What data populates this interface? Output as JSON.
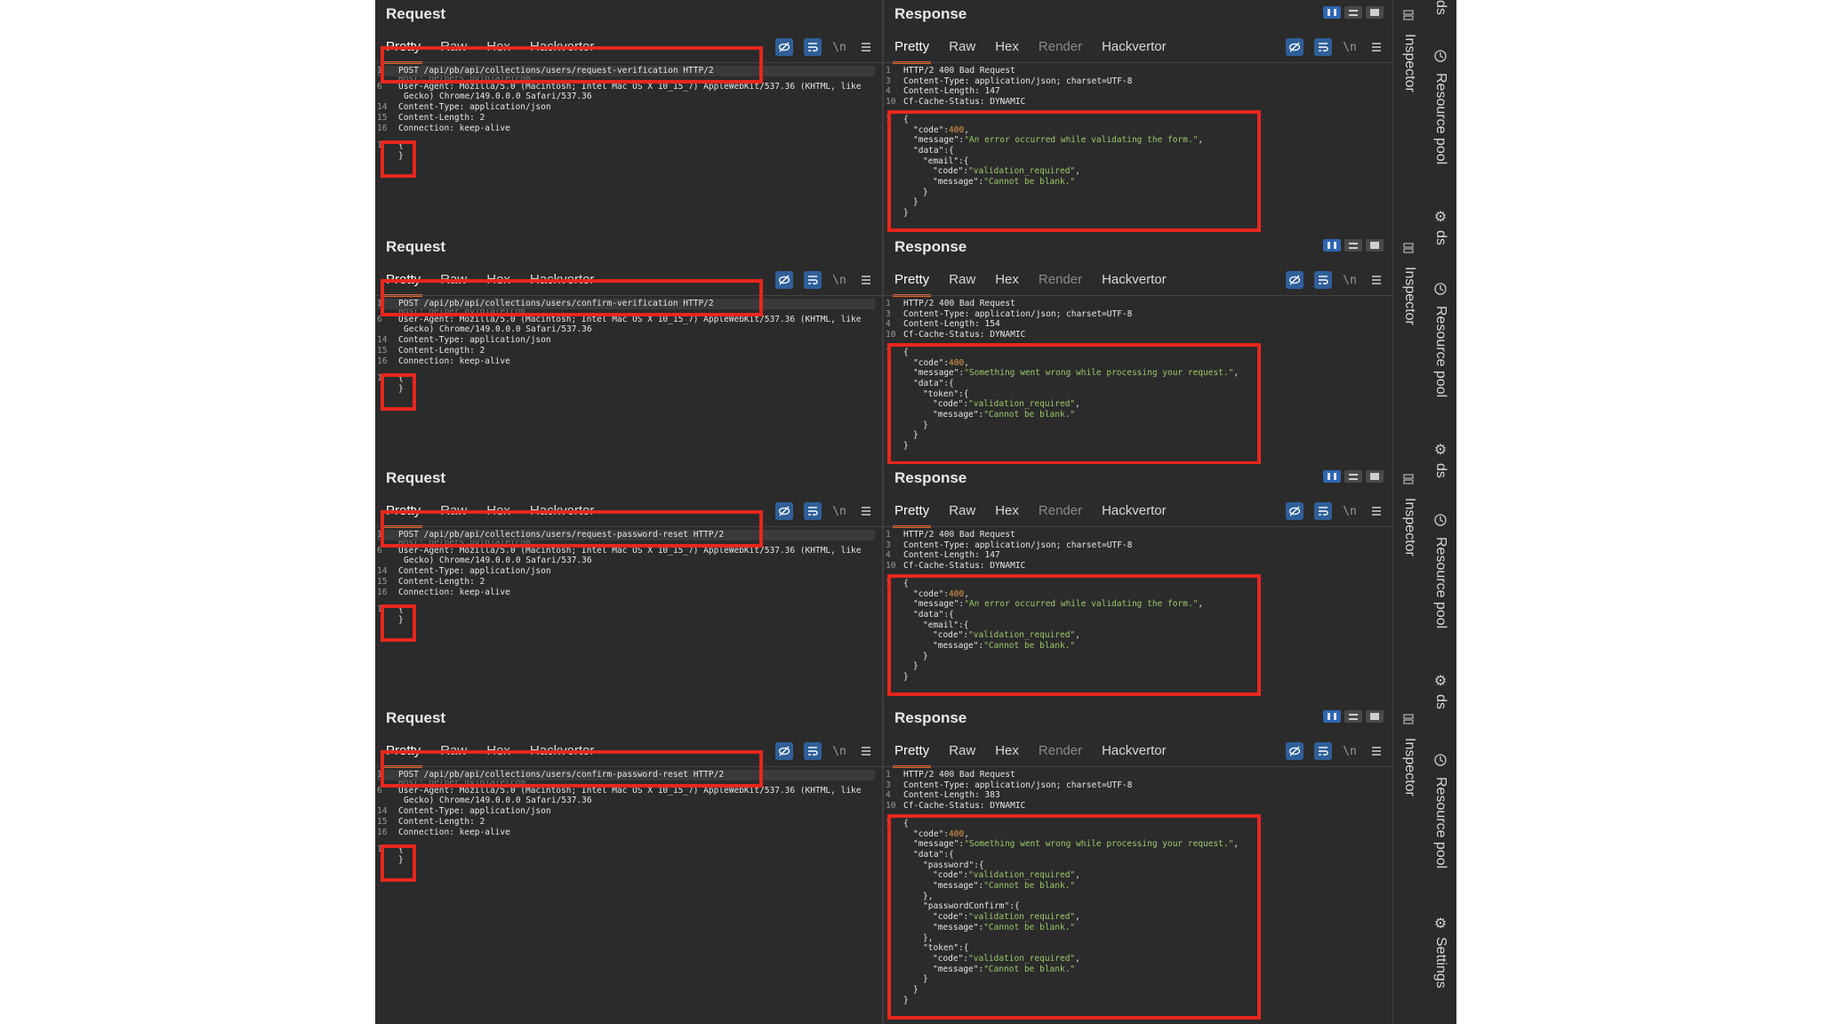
{
  "request_pane": {
    "title": "Request",
    "tabs": [
      "Pretty",
      "Raw",
      "Hex",
      "Hackvertor"
    ]
  },
  "response_pane": {
    "title": "Response",
    "tabs": [
      "Pretty",
      "Raw",
      "Hex",
      "Render",
      "Hackvertor"
    ]
  },
  "tools": {
    "newline_label": "\\n"
  },
  "sidebar": {
    "inspector": "Inspector",
    "resource_pool": "Resource pool",
    "settings": "Settings",
    "ds": "ds"
  },
  "rows": [
    {
      "request": {
        "request_line": "POST /api/pb/api/collections/users/request-verification HTTP/2",
        "host_line": "Host: helpers.dyjbjafetcom",
        "ua_line_a": "User-Agent: Mozilla/5.0 (Macintosh; Intel Mac OS X 10_15_7) AppleWebKit/537.36 (KHTML, like",
        "ua_line_b": "Gecko) Chrome/149.0.0.0 Safari/537.36",
        "content_type": "Content-Type: application/json",
        "content_length": "Content-Length: 2",
        "connection": "Connection: keep-alive",
        "body_open": "{",
        "body_close": "}"
      },
      "response": {
        "status": "HTTP/2 400 Bad Request",
        "content_type": "Content-Type: application/json; charset=UTF-8",
        "content_length": "Content-Length: 147",
        "cache": "Cf-Cache-Status: DYNAMIC",
        "body_lines": [
          {
            "indent": 0,
            "t": "{"
          },
          {
            "indent": 1,
            "key": "\"code\":",
            "num": "400",
            "tail": ","
          },
          {
            "indent": 1,
            "key": "\"message\":",
            "str": "\"An error occurred while validating the form.\"",
            "tail": ","
          },
          {
            "indent": 1,
            "key": "\"data\":",
            "tail": "{"
          },
          {
            "indent": 2,
            "key": "\"email\":",
            "tail": "{"
          },
          {
            "indent": 3,
            "key": "\"code\":",
            "str": "\"validation_required\"",
            "tail": ","
          },
          {
            "indent": 3,
            "key": "\"message\":",
            "str": "\"Cannot be blank.\""
          },
          {
            "indent": 2,
            "t": "}"
          },
          {
            "indent": 1,
            "t": "}"
          },
          {
            "indent": 0,
            "t": "}"
          }
        ]
      }
    },
    {
      "request": {
        "request_line": "POST /api/pb/api/collections/users/confirm-verification HTTP/2",
        "host_line": "Host: helper.dyjbjafetcom",
        "ua_line_a": "User-Agent: Mozilla/5.0 (Macintosh; Intel Mac OS X 10_15_7) AppleWebKit/537.36 (KHTML, like",
        "ua_line_b": "Gecko) Chrome/149.0.0.0 Safari/537.36",
        "content_type": "Content-Type: application/json",
        "content_length": "Content-Length: 2",
        "connection": "Connection: keep-alive",
        "body_open": "{",
        "body_close": "}"
      },
      "response": {
        "status": "HTTP/2 400 Bad Request",
        "content_type": "Content-Type: application/json; charset=UTF-8",
        "content_length": "Content-Length: 154",
        "cache": "Cf-Cache-Status: DYNAMIC",
        "body_lines": [
          {
            "indent": 0,
            "t": "{"
          },
          {
            "indent": 1,
            "key": "\"code\":",
            "num": "400",
            "tail": ","
          },
          {
            "indent": 1,
            "key": "\"message\":",
            "str": "\"Something went wrong while processing your request.\"",
            "tail": ","
          },
          {
            "indent": 1,
            "key": "\"data\":",
            "tail": "{"
          },
          {
            "indent": 2,
            "key": "\"token\":",
            "tail": "{"
          },
          {
            "indent": 3,
            "key": "\"code\":",
            "str": "\"validation_required\"",
            "tail": ","
          },
          {
            "indent": 3,
            "key": "\"message\":",
            "str": "\"Cannot be blank.\""
          },
          {
            "indent": 2,
            "t": "}"
          },
          {
            "indent": 1,
            "t": "}"
          },
          {
            "indent": 0,
            "t": "}"
          }
        ]
      }
    },
    {
      "request": {
        "request_line": "POST /api/pb/api/collections/users/request-password-reset HTTP/2",
        "host_line": "Host: helpers.dyjbjafetcom",
        "ua_line_a": "User-Agent: Mozilla/5.0 (Macintosh; Intel Mac OS X 10_15_7) AppleWebKit/537.36 (KHTML, like",
        "ua_line_b": "Gecko) Chrome/149.0.0.0 Safari/537.36",
        "content_type": "Content-Type: application/json",
        "content_length": "Content-Length: 2",
        "connection": "Connection: keep-alive",
        "body_open": "{",
        "body_close": "}"
      },
      "response": {
        "status": "HTTP/2 400 Bad Request",
        "content_type": "Content-Type: application/json; charset=UTF-8",
        "content_length": "Content-Length: 147",
        "cache": "Cf-Cache-Status: DYNAMIC",
        "body_lines": [
          {
            "indent": 0,
            "t": "{"
          },
          {
            "indent": 1,
            "key": "\"code\":",
            "num": "400",
            "tail": ","
          },
          {
            "indent": 1,
            "key": "\"message\":",
            "str": "\"An error occurred while validating the form.\"",
            "tail": ","
          },
          {
            "indent": 1,
            "key": "\"data\":",
            "tail": "{"
          },
          {
            "indent": 2,
            "key": "\"email\":",
            "tail": "{"
          },
          {
            "indent": 3,
            "key": "\"code\":",
            "str": "\"validation_required\"",
            "tail": ","
          },
          {
            "indent": 3,
            "key": "\"message\":",
            "str": "\"Cannot be blank.\""
          },
          {
            "indent": 2,
            "t": "}"
          },
          {
            "indent": 1,
            "t": "}"
          },
          {
            "indent": 0,
            "t": "}"
          }
        ]
      }
    },
    {
      "request": {
        "request_line": "POST /api/pb/api/collections/users/confirm-password-reset HTTP/2",
        "host_line": "Host: helper.dyjbjafetcom",
        "ua_line_a": "User-Agent: Mozilla/5.0 (Macintosh; Intel Mac OS X 10_15_7) AppleWebKit/537.36 (KHTML, like",
        "ua_line_b": "Gecko) Chrome/149.0.0.0 Safari/537.36",
        "content_type": "Content-Type: application/json",
        "content_length": "Content-Length: 2",
        "connection": "Connection: keep-alive",
        "body_open": "{",
        "body_close": "}"
      },
      "response": {
        "status": "HTTP/2 400 Bad Request",
        "content_type": "Content-Type: application/json; charset=UTF-8",
        "content_length": "Content-Length: 383",
        "cache": "Cf-Cache-Status: DYNAMIC",
        "body_lines": [
          {
            "indent": 0,
            "t": "{"
          },
          {
            "indent": 1,
            "key": "\"code\":",
            "num": "400",
            "tail": ","
          },
          {
            "indent": 1,
            "key": "\"message\":",
            "str": "\"Something went wrong while processing your request.\"",
            "tail": ","
          },
          {
            "indent": 1,
            "key": "\"data\":",
            "tail": "{"
          },
          {
            "indent": 2,
            "key": "\"password\":",
            "tail": "{"
          },
          {
            "indent": 3,
            "key": "\"code\":",
            "str": "\"validation_required\"",
            "tail": ","
          },
          {
            "indent": 3,
            "key": "\"message\":",
            "str": "\"Cannot be blank.\""
          },
          {
            "indent": 2,
            "t": "},"
          },
          {
            "indent": 2,
            "key": "\"passwordConfirm\":",
            "tail": "{"
          },
          {
            "indent": 3,
            "key": "\"code\":",
            "str": "\"validation_required\"",
            "tail": ","
          },
          {
            "indent": 3,
            "key": "\"message\":",
            "str": "\"Cannot be blank.\""
          },
          {
            "indent": 2,
            "t": "},"
          },
          {
            "indent": 2,
            "key": "\"token\":",
            "tail": "{"
          },
          {
            "indent": 3,
            "key": "\"code\":",
            "str": "\"validation_required\"",
            "tail": ","
          },
          {
            "indent": 3,
            "key": "\"message\":",
            "str": "\"Cannot be blank.\""
          },
          {
            "indent": 2,
            "t": "}"
          },
          {
            "indent": 1,
            "t": "}"
          },
          {
            "indent": 0,
            "t": "}"
          }
        ]
      }
    }
  ]
}
